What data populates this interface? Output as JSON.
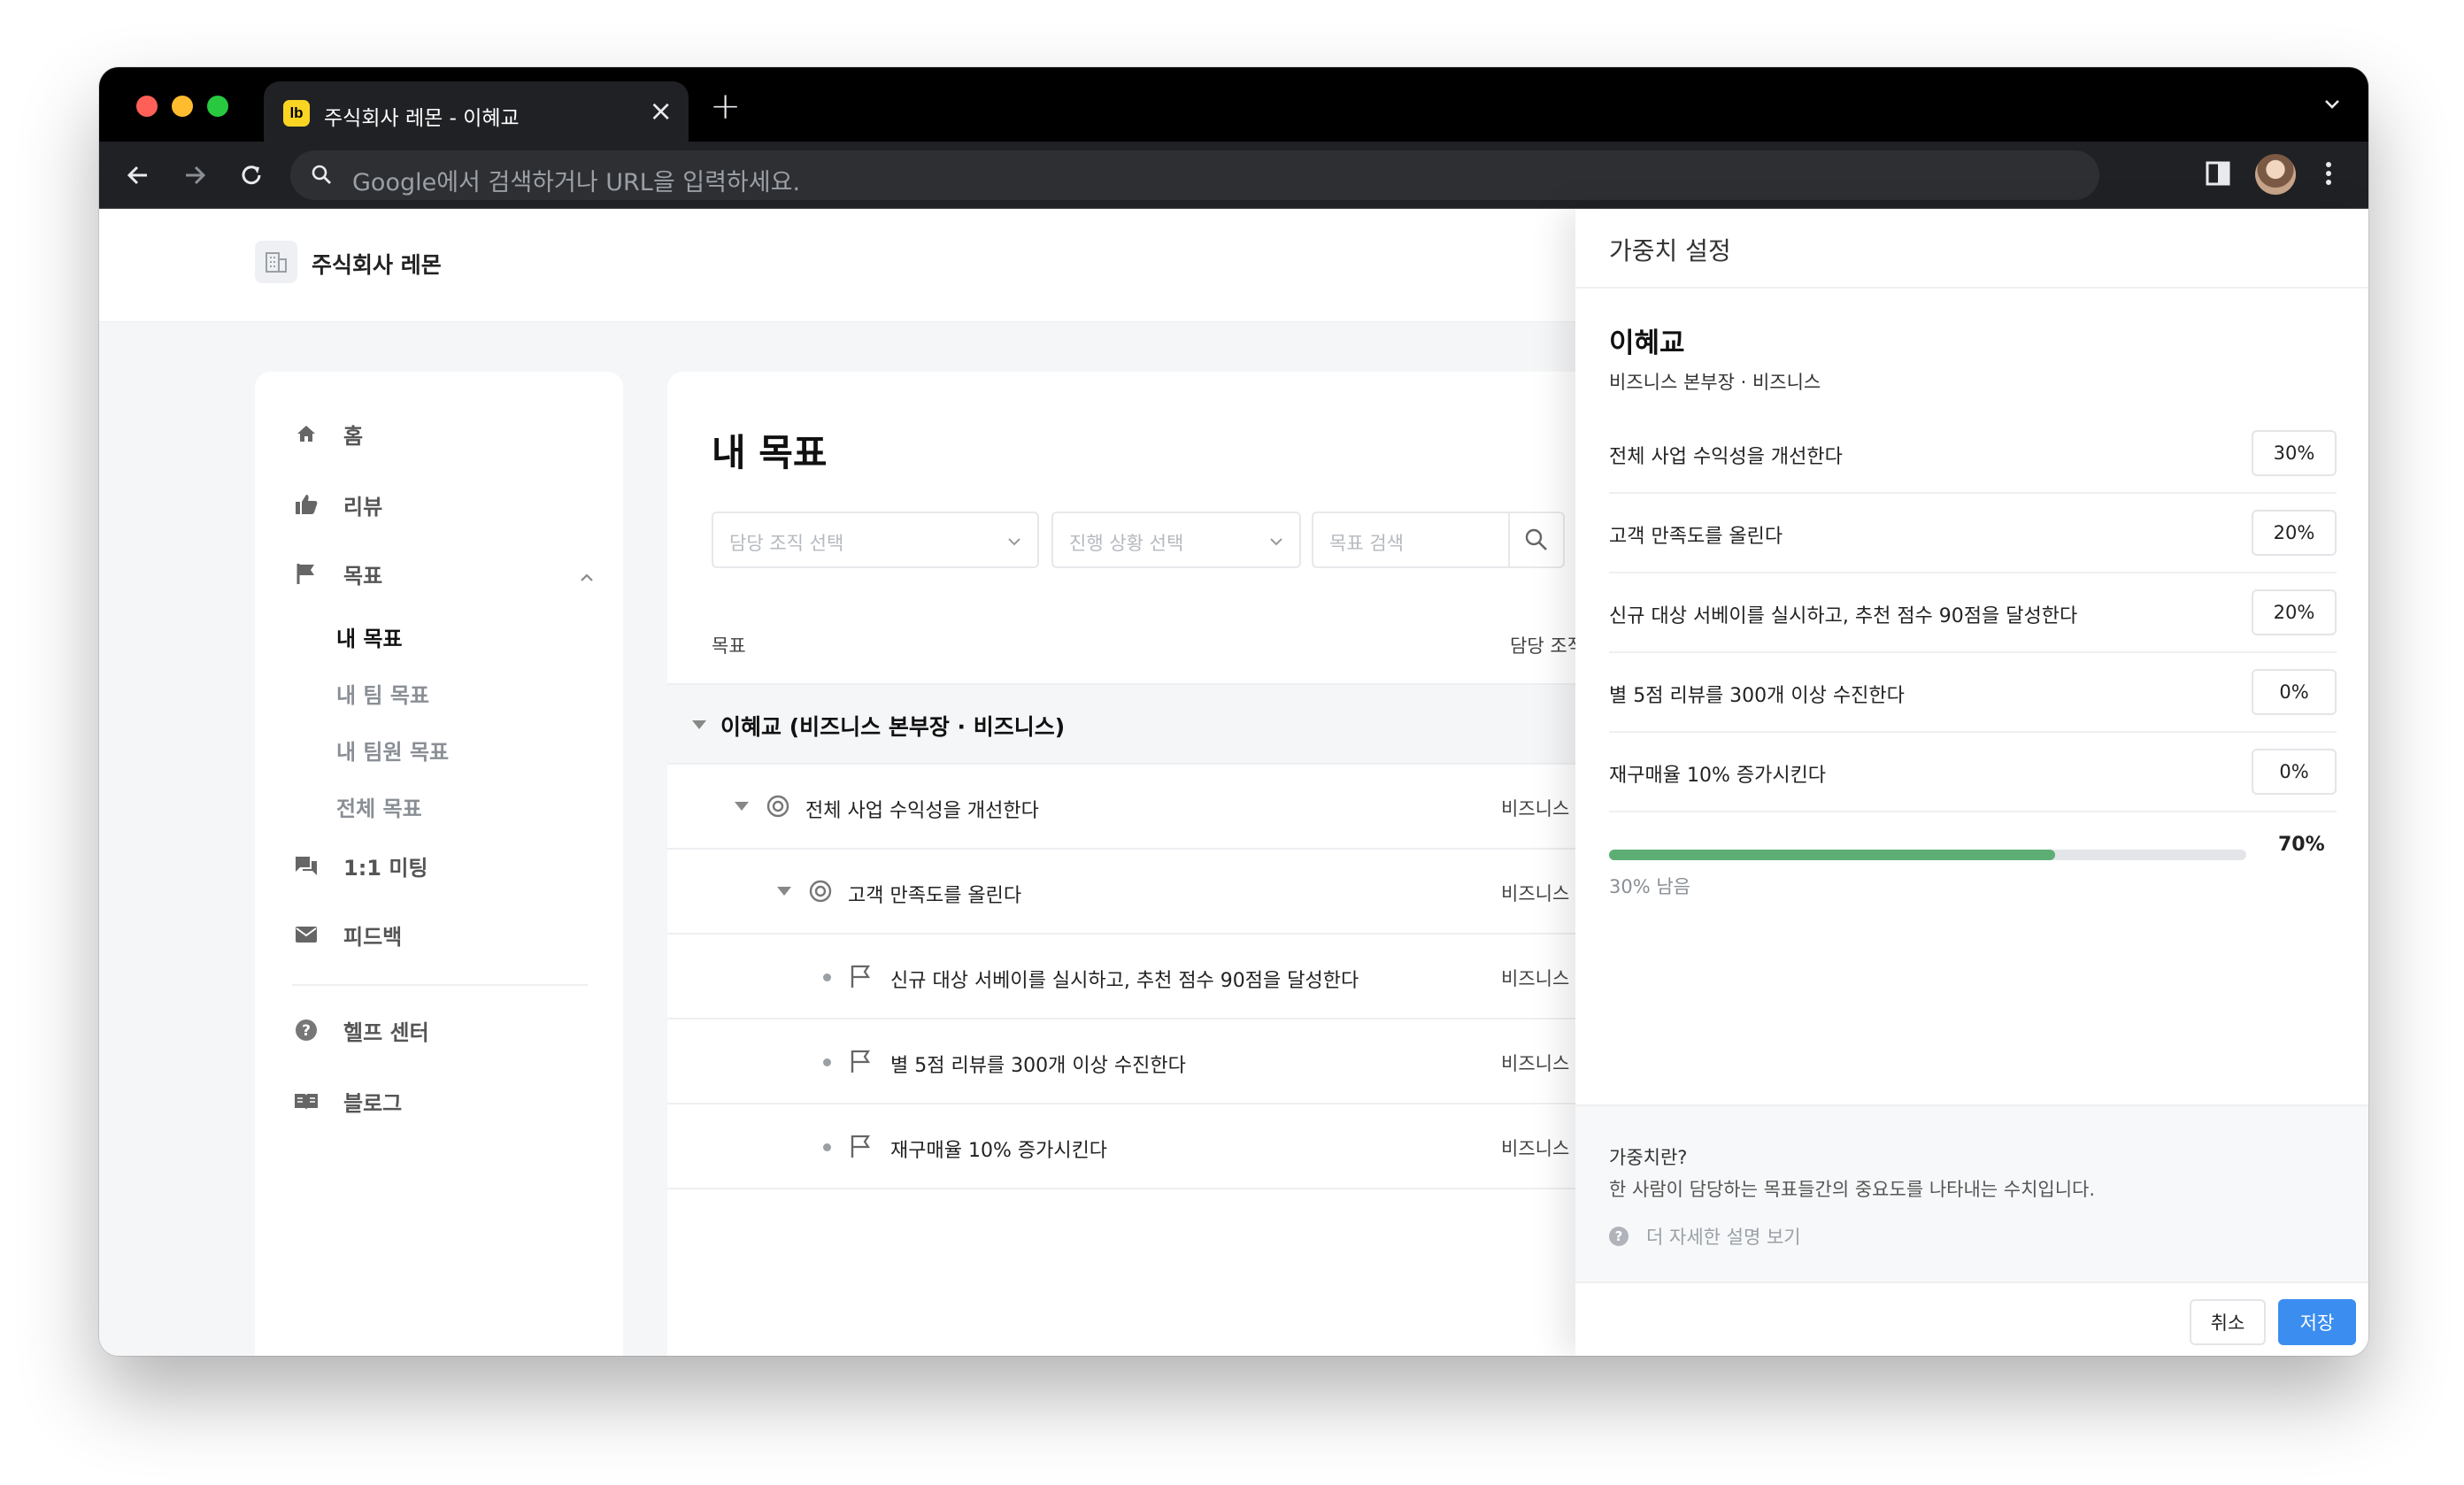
{
  "browser": {
    "tab_favicon": "lb",
    "tab_title": "주식회사 레몬 - 이혜교",
    "omnibox_placeholder": "Google에서 검색하거나 URL을 입력하세요."
  },
  "header": {
    "org_name": "주식회사 레몬"
  },
  "sidebar": {
    "items": [
      {
        "label": "홈",
        "icon": "home-icon"
      },
      {
        "label": "리뷰",
        "icon": "thumbs-up-icon"
      },
      {
        "label": "목표",
        "icon": "flag-icon"
      }
    ],
    "goal_sub_items": [
      {
        "label": "내 목표",
        "active": true
      },
      {
        "label": "내 팀 목표",
        "active": false
      },
      {
        "label": "내 팀원 목표",
        "active": false
      },
      {
        "label": "전체 목표",
        "active": false
      }
    ],
    "lower_items": [
      {
        "label": "1:1 미팅",
        "icon": "chat-icon"
      },
      {
        "label": "피드백",
        "icon": "mail-icon"
      },
      {
        "label": "헬프 센터",
        "icon": "help-icon"
      },
      {
        "label": "블로그",
        "icon": "book-icon"
      }
    ]
  },
  "main": {
    "title": "내 목표",
    "filters": {
      "org_placeholder": "담당 조직 선택",
      "status_placeholder": "진행 상황 선택",
      "search_placeholder": "목표 검색"
    },
    "columns": {
      "goal": "목표",
      "org": "담당 조직"
    },
    "group_label": "이혜교 (비즈니스 본부장 · 비즈니스)",
    "rows": [
      {
        "label": "전체 사업 수익성을 개선한다",
        "org": "비즈니스",
        "type": "objective"
      },
      {
        "label": "고객 만족도를 올린다",
        "org": "비즈니스",
        "type": "objective"
      },
      {
        "label": "신규 대상 서베이를 실시하고, 추천 점수 90점을 달성한다",
        "org": "비즈니스",
        "type": "key-result"
      },
      {
        "label": "별 5점 리뷰를 300개 이상 수진한다",
        "org": "비즈니스",
        "type": "key-result"
      },
      {
        "label": "재구매율 10% 증가시킨다",
        "org": "비즈니스",
        "type": "key-result"
      }
    ]
  },
  "panel": {
    "title": "가중치 설정",
    "person_name": "이혜교",
    "person_sub": "비즈니스 본부장 · 비즈니스",
    "weights": [
      {
        "label": "전체 사업 수익성을 개선한다",
        "value": "30%"
      },
      {
        "label": "고객 만족도를 올린다",
        "value": "20%"
      },
      {
        "label": "신규 대상 서베이를 실시하고, 추천 점수 90점을 달성한다",
        "value": "20%"
      },
      {
        "label": "별 5점 리뷰를 300개 이상 수진한다",
        "value": "0%"
      },
      {
        "label": "재구매율 10% 증가시킨다",
        "value": "0%"
      }
    ],
    "progress_fraction": 0.7,
    "progress_label": "70%",
    "remaining_label": "30% 남음",
    "info_question": "가중치란?",
    "info_answer": "한 사람이 담당하는 목표들간의 중요도를 나타내는 수치입니다.",
    "info_link": "더 자세한 설명 보기",
    "cancel_label": "취소",
    "save_label": "저장"
  },
  "colors": {
    "accent": "#3b8ef0",
    "progress": "#5dae74"
  }
}
